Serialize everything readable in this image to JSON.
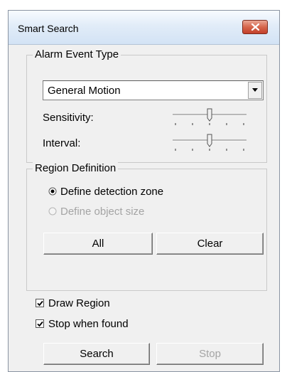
{
  "window": {
    "title": "Smart Search"
  },
  "alarm": {
    "legend": "Alarm Event Type",
    "event_type": "General Motion",
    "sensitivity_label": "Sensitivity:",
    "sensitivity_level": 0.5,
    "interval_label": "Interval:",
    "interval_level": 0.5
  },
  "region": {
    "legend": "Region Definition",
    "options": [
      "Define detection zone",
      "Define object size"
    ],
    "selected": "Define detection zone",
    "all_label": "All",
    "clear_label": "Clear"
  },
  "options": {
    "draw_region_label": "Draw Region",
    "draw_region_checked": true,
    "stop_when_found_label": "Stop when found",
    "stop_when_found_checked": true
  },
  "actions": {
    "search_label": "Search",
    "stop_label": "Stop"
  }
}
